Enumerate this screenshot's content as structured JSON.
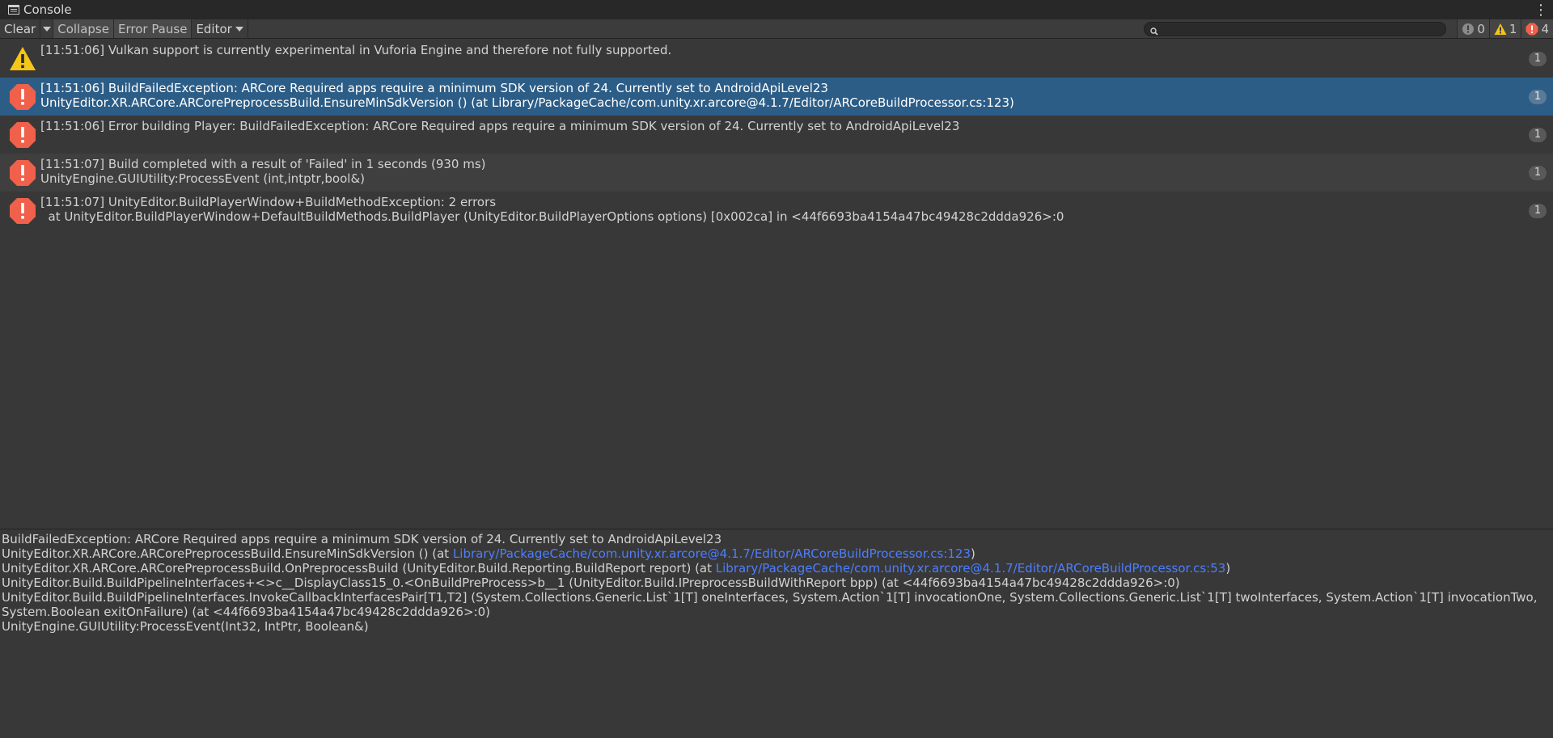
{
  "tab": {
    "title": "Console"
  },
  "toolbar": {
    "clear_label": "Clear",
    "collapse_label": "Collapse",
    "error_pause_label": "Error Pause",
    "editor_label": "Editor",
    "search_placeholder": ""
  },
  "counters": {
    "info": "0",
    "warning": "1",
    "error": "4"
  },
  "colors": {
    "selected_row": "#2c5d87",
    "error_icon": "#f0604a",
    "warning_icon": "#f5c518",
    "link": "#4c7eff"
  },
  "logs": [
    {
      "type": "warning",
      "icon": "warning-icon",
      "line1": "[11:51:06] Vulkan support is currently experimental in Vuforia Engine and therefore not fully supported.",
      "line2": "",
      "count": "1"
    },
    {
      "type": "error",
      "icon": "error-icon",
      "line1": "[11:51:06] BuildFailedException: ARCore Required apps require a minimum SDK version of 24. Currently set to AndroidApiLevel23",
      "line2": "UnityEditor.XR.ARCore.ARCorePreprocessBuild.EnsureMinSdkVersion () (at Library/PackageCache/com.unity.xr.arcore@4.1.7/Editor/ARCoreBuildProcessor.cs:123)",
      "count": "1"
    },
    {
      "type": "error",
      "icon": "error-icon",
      "line1": "[11:51:06] Error building Player: BuildFailedException: ARCore Required apps require a minimum SDK version of 24. Currently set to AndroidApiLevel23",
      "line2": "",
      "count": "1"
    },
    {
      "type": "error",
      "icon": "error-icon",
      "line1": "[11:51:07] Build completed with a result of 'Failed' in 1 seconds (930 ms)",
      "line2": "UnityEngine.GUIUtility:ProcessEvent (int,intptr,bool&)",
      "count": "1"
    },
    {
      "type": "error",
      "icon": "error-icon",
      "line1": "[11:51:07] UnityEditor.BuildPlayerWindow+BuildMethodException: 2 errors",
      "line2": "  at UnityEditor.BuildPlayerWindow+DefaultBuildMethods.BuildPlayer (UnityEditor.BuildPlayerOptions options) [0x002ca] in <44f6693ba4154a47bc49428c2ddda926>:0",
      "count": "1"
    }
  ],
  "detail": {
    "line1": "BuildFailedException: ARCore Required apps require a minimum SDK version of 24. Currently set to AndroidApiLevel23",
    "line2_pre": "UnityEditor.XR.ARCore.ARCorePreprocessBuild.EnsureMinSdkVersion () (at ",
    "line2_link": "Library/PackageCache/com.unity.xr.arcore@4.1.7/Editor/ARCoreBuildProcessor.cs:123",
    "line2_post": ")",
    "line3_pre": "UnityEditor.XR.ARCore.ARCorePreprocessBuild.OnPreprocessBuild (UnityEditor.Build.Reporting.BuildReport report) (at ",
    "line3_link": "Library/PackageCache/com.unity.xr.arcore@4.1.7/Editor/ARCoreBuildProcessor.cs:53",
    "line3_post": ")",
    "line4": "UnityEditor.Build.BuildPipelineInterfaces+<>c__DisplayClass15_0.<OnBuildPreProcess>b__1 (UnityEditor.Build.IPreprocessBuildWithReport bpp) (at <44f6693ba4154a47bc49428c2ddda926>:0)",
    "line5": "UnityEditor.Build.BuildPipelineInterfaces.InvokeCallbackInterfacesPair[T1,T2] (System.Collections.Generic.List`1[T] oneInterfaces, System.Action`1[T] invocationOne, System.Collections.Generic.List`1[T] twoInterfaces, System.Action`1[T] invocationTwo,",
    "line6": "System.Boolean exitOnFailure) (at <44f6693ba4154a47bc49428c2ddda926>:0)",
    "line7": "UnityEngine.GUIUtility:ProcessEvent(Int32, IntPtr, Boolean&)"
  }
}
